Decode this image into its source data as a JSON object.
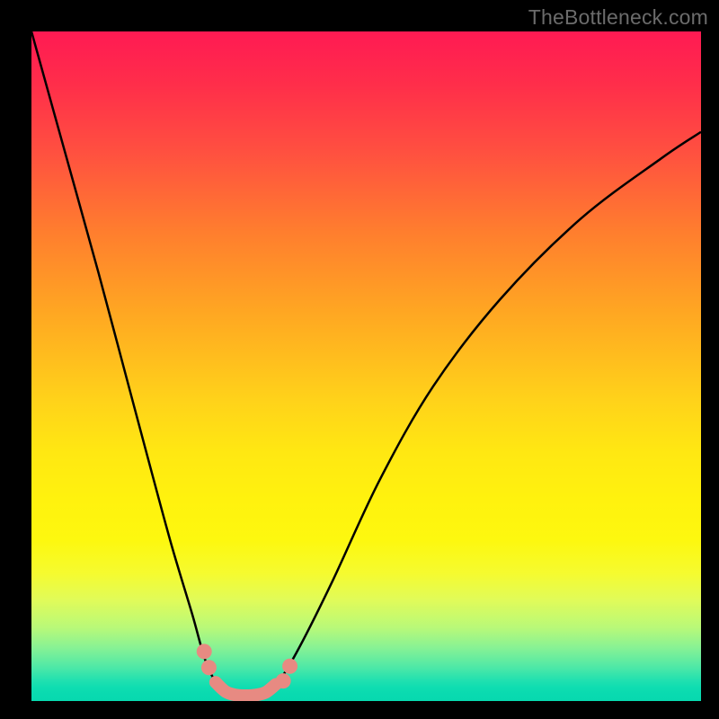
{
  "watermark": "TheBottleneck.com",
  "chart_data": {
    "type": "line",
    "title": "",
    "xlabel": "",
    "ylabel": "",
    "xlim": [
      0,
      100
    ],
    "ylim": [
      0,
      100
    ],
    "grid": false,
    "series": [
      {
        "name": "curve",
        "x": [
          0,
          5,
          10,
          14,
          18,
          21,
          24,
          26,
          28,
          29.5,
          31,
          33,
          35,
          37,
          40,
          45,
          52,
          60,
          70,
          82,
          94,
          100
        ],
        "values": [
          100,
          82,
          64,
          49,
          34,
          23,
          13,
          6,
          2,
          0.8,
          0.6,
          0.6,
          1.2,
          3,
          8,
          18,
          33,
          47,
          60,
          72,
          81,
          85
        ]
      }
    ],
    "markers": [
      {
        "name": "left-dot-upper",
        "x": 25.8,
        "y": 7.4
      },
      {
        "name": "left-dot-lower",
        "x": 26.5,
        "y": 5.0
      },
      {
        "name": "right-dot-upper",
        "x": 38.6,
        "y": 5.2
      },
      {
        "name": "right-dot-lower",
        "x": 37.6,
        "y": 3.0
      }
    ],
    "basin": {
      "name": "basin-stroke",
      "x": [
        27.5,
        29,
        30.5,
        32,
        33.5,
        35,
        36.5
      ],
      "values": [
        2.8,
        1.4,
        0.9,
        0.8,
        0.9,
        1.3,
        2.5
      ]
    },
    "colors": {
      "curve": "#000000",
      "markers": "#e78a82",
      "basin": "#e78a82"
    }
  }
}
